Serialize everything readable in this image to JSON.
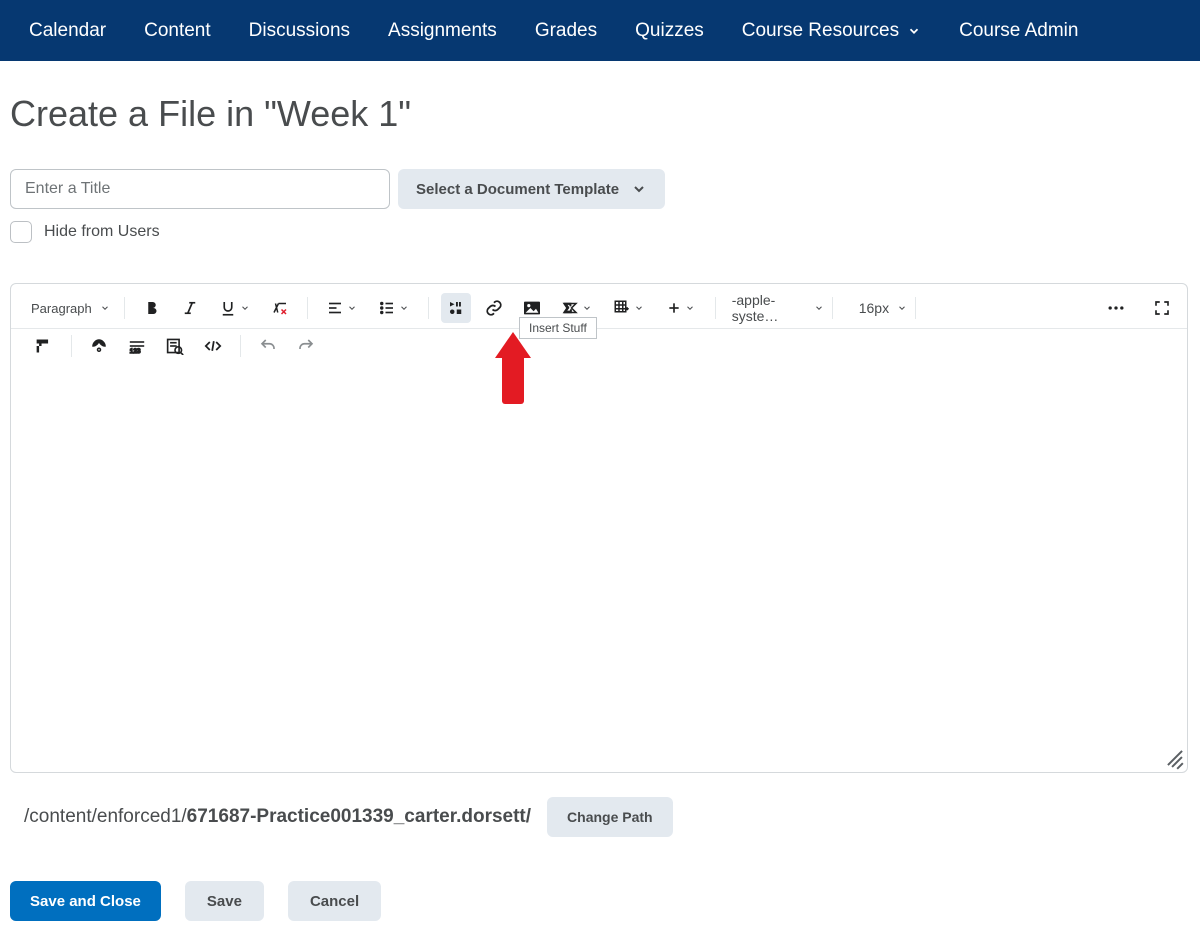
{
  "nav": {
    "items": [
      "Calendar",
      "Content",
      "Discussions",
      "Assignments",
      "Grades",
      "Quizzes",
      "Course Resources",
      "Course Admin"
    ],
    "dropdown_index": 6
  },
  "page": {
    "title": "Create a File in \"Week 1\"",
    "input_placeholder": "Enter a Title",
    "template_label": "Select a Document Template",
    "hide_label": "Hide from Users"
  },
  "toolbar": {
    "format_label": "Paragraph",
    "font_family": "-apple-syste…",
    "font_size": "16px",
    "tooltip": "Insert Stuff"
  },
  "path": {
    "prefix": "/content/enforced1/",
    "bold": "671687-Practice001339_carter.dorsett/",
    "button": "Change Path"
  },
  "actions": {
    "primary": "Save and Close",
    "save": "Save",
    "cancel": "Cancel"
  }
}
